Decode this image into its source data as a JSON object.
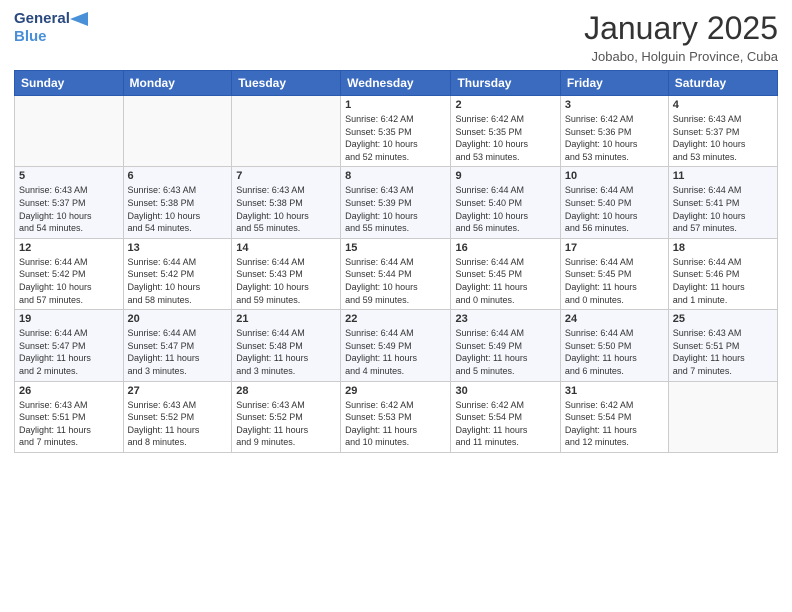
{
  "header": {
    "logo_line1": "General",
    "logo_line2": "Blue",
    "month": "January 2025",
    "location": "Jobabo, Holguin Province, Cuba"
  },
  "days_of_week": [
    "Sunday",
    "Monday",
    "Tuesday",
    "Wednesday",
    "Thursday",
    "Friday",
    "Saturday"
  ],
  "weeks": [
    [
      {
        "day": "",
        "info": ""
      },
      {
        "day": "",
        "info": ""
      },
      {
        "day": "",
        "info": ""
      },
      {
        "day": "1",
        "info": "Sunrise: 6:42 AM\nSunset: 5:35 PM\nDaylight: 10 hours\nand 52 minutes."
      },
      {
        "day": "2",
        "info": "Sunrise: 6:42 AM\nSunset: 5:35 PM\nDaylight: 10 hours\nand 53 minutes."
      },
      {
        "day": "3",
        "info": "Sunrise: 6:42 AM\nSunset: 5:36 PM\nDaylight: 10 hours\nand 53 minutes."
      },
      {
        "day": "4",
        "info": "Sunrise: 6:43 AM\nSunset: 5:37 PM\nDaylight: 10 hours\nand 53 minutes."
      }
    ],
    [
      {
        "day": "5",
        "info": "Sunrise: 6:43 AM\nSunset: 5:37 PM\nDaylight: 10 hours\nand 54 minutes."
      },
      {
        "day": "6",
        "info": "Sunrise: 6:43 AM\nSunset: 5:38 PM\nDaylight: 10 hours\nand 54 minutes."
      },
      {
        "day": "7",
        "info": "Sunrise: 6:43 AM\nSunset: 5:38 PM\nDaylight: 10 hours\nand 55 minutes."
      },
      {
        "day": "8",
        "info": "Sunrise: 6:43 AM\nSunset: 5:39 PM\nDaylight: 10 hours\nand 55 minutes."
      },
      {
        "day": "9",
        "info": "Sunrise: 6:44 AM\nSunset: 5:40 PM\nDaylight: 10 hours\nand 56 minutes."
      },
      {
        "day": "10",
        "info": "Sunrise: 6:44 AM\nSunset: 5:40 PM\nDaylight: 10 hours\nand 56 minutes."
      },
      {
        "day": "11",
        "info": "Sunrise: 6:44 AM\nSunset: 5:41 PM\nDaylight: 10 hours\nand 57 minutes."
      }
    ],
    [
      {
        "day": "12",
        "info": "Sunrise: 6:44 AM\nSunset: 5:42 PM\nDaylight: 10 hours\nand 57 minutes."
      },
      {
        "day": "13",
        "info": "Sunrise: 6:44 AM\nSunset: 5:42 PM\nDaylight: 10 hours\nand 58 minutes."
      },
      {
        "day": "14",
        "info": "Sunrise: 6:44 AM\nSunset: 5:43 PM\nDaylight: 10 hours\nand 59 minutes."
      },
      {
        "day": "15",
        "info": "Sunrise: 6:44 AM\nSunset: 5:44 PM\nDaylight: 10 hours\nand 59 minutes."
      },
      {
        "day": "16",
        "info": "Sunrise: 6:44 AM\nSunset: 5:45 PM\nDaylight: 11 hours\nand 0 minutes."
      },
      {
        "day": "17",
        "info": "Sunrise: 6:44 AM\nSunset: 5:45 PM\nDaylight: 11 hours\nand 0 minutes."
      },
      {
        "day": "18",
        "info": "Sunrise: 6:44 AM\nSunset: 5:46 PM\nDaylight: 11 hours\nand 1 minute."
      }
    ],
    [
      {
        "day": "19",
        "info": "Sunrise: 6:44 AM\nSunset: 5:47 PM\nDaylight: 11 hours\nand 2 minutes."
      },
      {
        "day": "20",
        "info": "Sunrise: 6:44 AM\nSunset: 5:47 PM\nDaylight: 11 hours\nand 3 minutes."
      },
      {
        "day": "21",
        "info": "Sunrise: 6:44 AM\nSunset: 5:48 PM\nDaylight: 11 hours\nand 3 minutes."
      },
      {
        "day": "22",
        "info": "Sunrise: 6:44 AM\nSunset: 5:49 PM\nDaylight: 11 hours\nand 4 minutes."
      },
      {
        "day": "23",
        "info": "Sunrise: 6:44 AM\nSunset: 5:49 PM\nDaylight: 11 hours\nand 5 minutes."
      },
      {
        "day": "24",
        "info": "Sunrise: 6:44 AM\nSunset: 5:50 PM\nDaylight: 11 hours\nand 6 minutes."
      },
      {
        "day": "25",
        "info": "Sunrise: 6:43 AM\nSunset: 5:51 PM\nDaylight: 11 hours\nand 7 minutes."
      }
    ],
    [
      {
        "day": "26",
        "info": "Sunrise: 6:43 AM\nSunset: 5:51 PM\nDaylight: 11 hours\nand 7 minutes."
      },
      {
        "day": "27",
        "info": "Sunrise: 6:43 AM\nSunset: 5:52 PM\nDaylight: 11 hours\nand 8 minutes."
      },
      {
        "day": "28",
        "info": "Sunrise: 6:43 AM\nSunset: 5:52 PM\nDaylight: 11 hours\nand 9 minutes."
      },
      {
        "day": "29",
        "info": "Sunrise: 6:42 AM\nSunset: 5:53 PM\nDaylight: 11 hours\nand 10 minutes."
      },
      {
        "day": "30",
        "info": "Sunrise: 6:42 AM\nSunset: 5:54 PM\nDaylight: 11 hours\nand 11 minutes."
      },
      {
        "day": "31",
        "info": "Sunrise: 6:42 AM\nSunset: 5:54 PM\nDaylight: 11 hours\nand 12 minutes."
      },
      {
        "day": "",
        "info": ""
      }
    ]
  ]
}
